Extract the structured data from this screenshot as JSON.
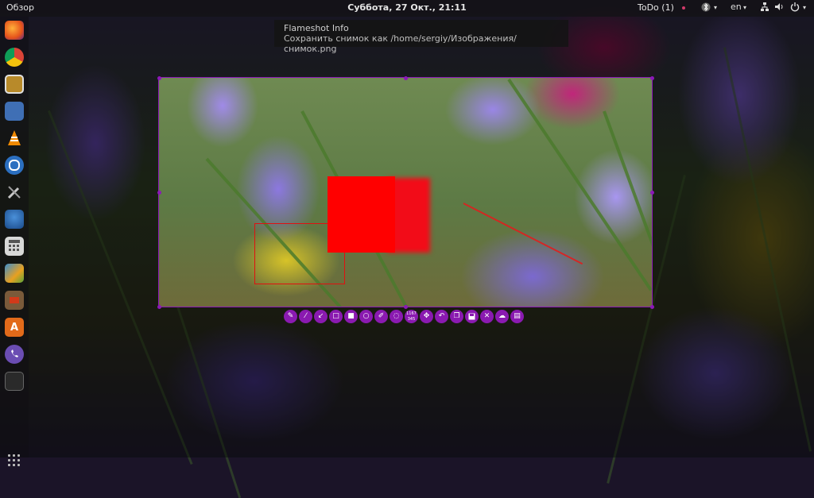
{
  "topbar": {
    "overview": "Обзор",
    "clock": "Суббота, 27 Окт., 21:11",
    "todo": "ToDo (1)",
    "language": "en",
    "tray_icons": [
      "bluetooth-icon",
      "network-icon",
      "power-icon"
    ]
  },
  "dock": {
    "apps": [
      "firefox-icon",
      "chrome-icon",
      "screenshot-app-icon",
      "notes-app-icon",
      "vlc-icon",
      "shutter-icon",
      "tools-icon",
      "thunderbird-icon",
      "calculator-icon",
      "image-viewer-icon",
      "terminal-app-icon",
      "software-center-icon",
      "viber-icon",
      "terminal-icon"
    ],
    "software_letter": "A"
  },
  "notification": {
    "title": "Flameshot Info",
    "body": "Сохранить снимок как /home/sergiy/Изображения/снимок.png"
  },
  "toolbar": {
    "tools": [
      "pencil",
      "line",
      "arrow",
      "rectangle",
      "filled-rectangle",
      "circle",
      "marker",
      "blur",
      "coords",
      "move",
      "undo",
      "copy",
      "save",
      "exit",
      "upload",
      "open-app"
    ],
    "coords_text": [
      "1167",
      "345"
    ]
  },
  "colors": {
    "accent": "#8a1ab0",
    "drawing_red": "#ff0000"
  }
}
